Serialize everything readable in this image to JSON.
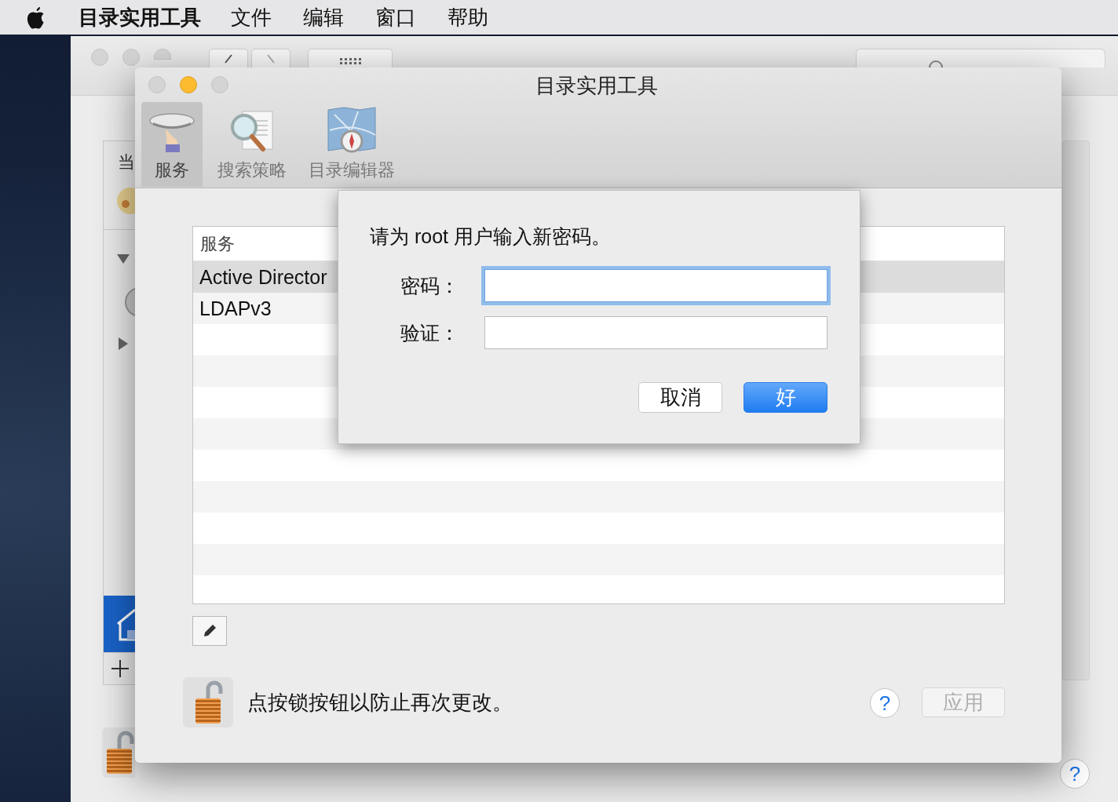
{
  "menu_bar": {
    "app_name": "目录实用工具",
    "items": [
      "文件",
      "编辑",
      "窗口",
      "帮助"
    ]
  },
  "back_window": {
    "sidebar_header": "当",
    "help_button": "?"
  },
  "window": {
    "title": "目录实用工具",
    "tabs": [
      {
        "label": "服务",
        "kind": "platter",
        "selected": true
      },
      {
        "label": "搜索策略",
        "kind": "magnifier",
        "selected": false
      },
      {
        "label": "目录编辑器",
        "kind": "map",
        "selected": false
      }
    ]
  },
  "services_table": {
    "columns": [
      "服务"
    ],
    "rows": [
      {
        "name": "Active Director",
        "selected": true
      },
      {
        "name": "LDAPv3",
        "selected": false
      }
    ]
  },
  "lock_message": "点按锁按钮以防止再次更改。",
  "help_button": "?",
  "apply_button": {
    "label": "应用",
    "disabled": true
  },
  "sheet": {
    "message": "请为 root 用户输入新密码。",
    "fields": [
      {
        "label": "密码：",
        "focused": true
      },
      {
        "label": "验证：",
        "focused": false
      }
    ],
    "buttons": [
      {
        "label": "取消",
        "kind": "secondary"
      },
      {
        "label": "好",
        "kind": "primary"
      }
    ]
  }
}
